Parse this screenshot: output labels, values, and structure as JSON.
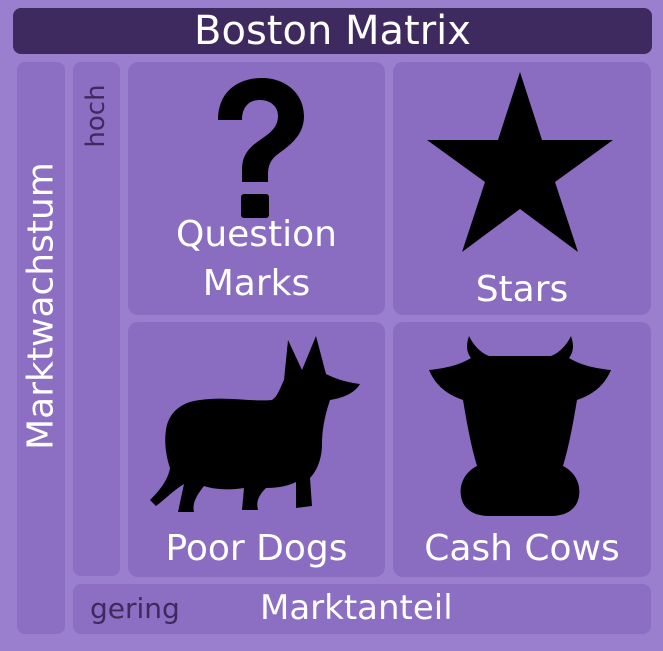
{
  "title": "Boston Matrix",
  "axes": {
    "y_label": "Marktwachstum",
    "y_high": "hoch",
    "x_label": "Marktanteil",
    "x_low": "gering"
  },
  "quadrants": [
    {
      "label_line1": "Question",
      "label_line2": "Marks",
      "icon": "question-mark-icon"
    },
    {
      "label": "Stars",
      "icon": "star-icon"
    },
    {
      "label": "Poor Dogs",
      "icon": "dog-icon"
    },
    {
      "label": "Cash Cows",
      "icon": "cow-icon"
    }
  ],
  "colors": {
    "background": "#9a7fcf",
    "quadrant": "#8a6dc1",
    "title_bar": "#3e2a5e",
    "icon": "#000000"
  }
}
